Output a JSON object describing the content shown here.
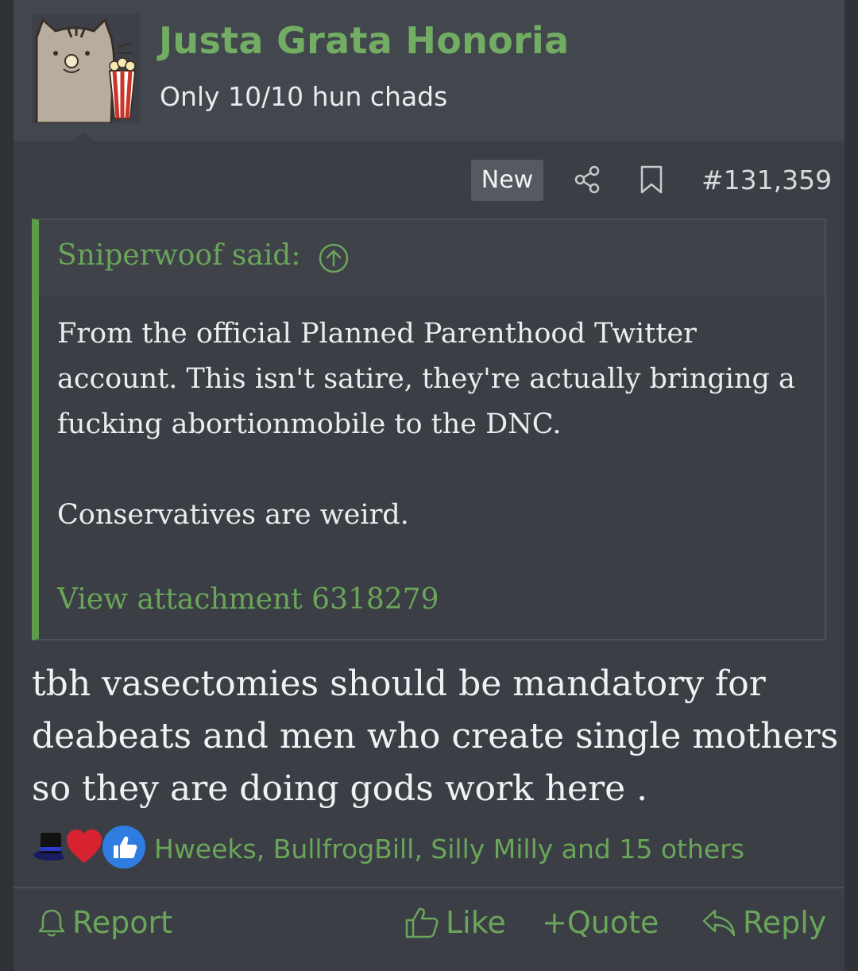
{
  "user": {
    "name": "Justa Grata Honoria",
    "title": "Only 10/10 hun chads",
    "avatar": "pusheen-cat-popcorn-avatar"
  },
  "meta": {
    "badge": "New",
    "post_number": "#131,359",
    "icons": [
      "share-icon",
      "bookmark-icon"
    ]
  },
  "quote": {
    "attribution": "Sniperwoof said:",
    "lines": [
      "From the official Planned Parenthood Twitter",
      "account. This isn't satire, they're actually bringing a",
      "fucking abortionmobile to the DNC."
    ],
    "line2": "Conservatives are weird.",
    "attachment": "View attachment 6318279"
  },
  "message": {
    "lines": [
      "tbh vasectomies should be mandatory for",
      "deabeats and men who create single mothers",
      "so they are doing gods work here ."
    ]
  },
  "reactions": {
    "icons": [
      "top-hat-icon",
      "heart-icon",
      "thumbs-up-icon"
    ],
    "names": "Hweeks, BullfrogBill, Silly Milly and 15 others"
  },
  "actions": {
    "report": "Report",
    "like": "Like",
    "quote": "+Quote",
    "reply": "Reply"
  },
  "colors": {
    "accent_green": "#6aa55a",
    "background": "#3b3f45",
    "header": "#42464d"
  }
}
